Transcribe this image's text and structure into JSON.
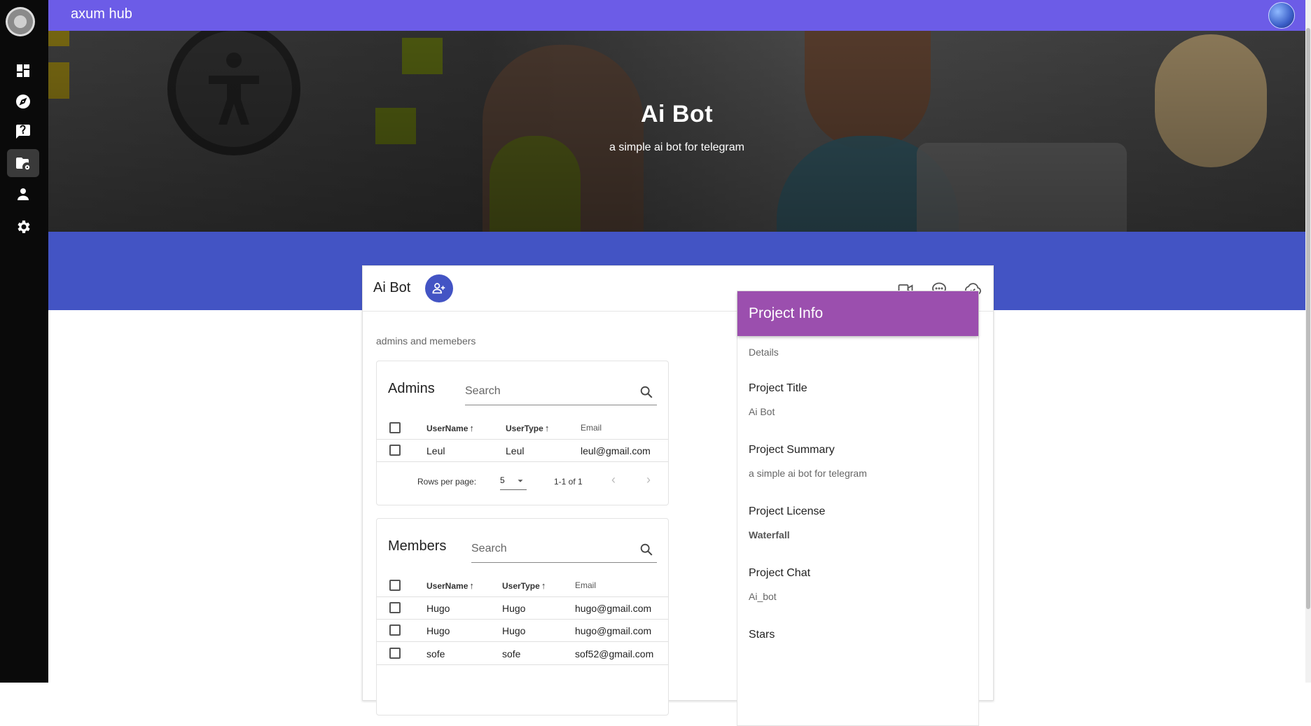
{
  "app": {
    "title": "axum hub"
  },
  "hero": {
    "title": "Ai Bot",
    "subtitle": "a simple ai bot for telegram"
  },
  "sidebar": {
    "items": [
      {
        "icon": "dashboard-icon"
      },
      {
        "icon": "compass-icon"
      },
      {
        "icon": "question-chat-icon"
      },
      {
        "icon": "folder-settings-icon"
      },
      {
        "icon": "user-icon"
      },
      {
        "icon": "gear-icon"
      }
    ]
  },
  "card": {
    "title": "Ai Bot",
    "section_caption": "admins and memebers",
    "header_icons": [
      "video-camera-icon",
      "chat-bubble-icon",
      "cloud-done-icon"
    ]
  },
  "admins": {
    "title": "Admins",
    "search_placeholder": "Search",
    "columns": [
      "UserName",
      "UserType",
      "Email"
    ],
    "rows": [
      {
        "username": "Leul",
        "usertype": "Leul",
        "email": "leul@gmail.com"
      }
    ],
    "rows_per_page_label": "Rows per page:",
    "rows_per_page": "5",
    "range": "1-1 of 1"
  },
  "members": {
    "title": "Members",
    "search_placeholder": "Search",
    "columns": [
      "UserName",
      "UserType",
      "Email"
    ],
    "rows": [
      {
        "username": "Hugo",
        "usertype": "Hugo",
        "email": "hugo@gmail.com"
      },
      {
        "username": "Hugo",
        "usertype": "Hugo",
        "email": "hugo@gmail.com"
      },
      {
        "username": "sofe",
        "usertype": "sofe",
        "email": "sof52@gmail.com"
      }
    ]
  },
  "project_info": {
    "title": "Project Info",
    "subtitle": "Details",
    "fields": [
      {
        "label": "Project Title",
        "value": "Ai Bot"
      },
      {
        "label": "Project Summary",
        "value": "a simple ai bot for telegram"
      },
      {
        "label": "Project License",
        "value": "Waterfall"
      },
      {
        "label": "Project Chat",
        "value": "Ai_bot"
      },
      {
        "label": "Stars",
        "value": ""
      }
    ]
  },
  "colors": {
    "topbar": "#6c5ce7",
    "band": "#4354c4",
    "info_header": "#9b4fae",
    "rail": "#0a0a0a"
  }
}
